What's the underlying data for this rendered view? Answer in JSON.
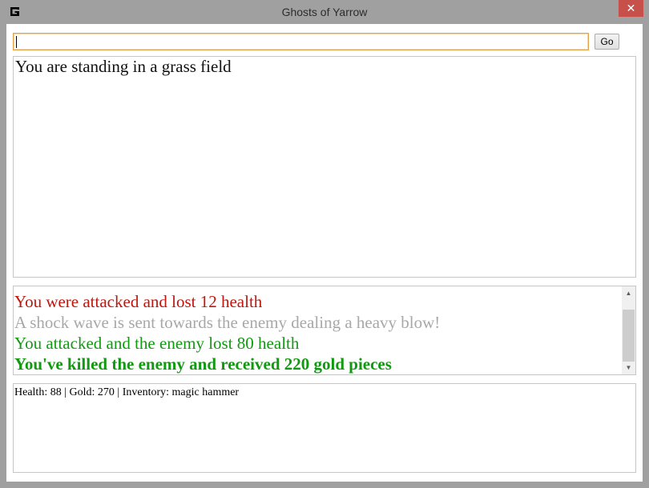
{
  "window": {
    "title": "Ghosts of Yarrow",
    "close_glyph": "✕"
  },
  "command": {
    "value": "",
    "go_label": "Go"
  },
  "location": {
    "text": "You are standing in a grass field"
  },
  "log": {
    "lines": [
      {
        "text": "You were attacked and lost 12 health",
        "color": "#c0140c",
        "bold": false
      },
      {
        "text": "A shock wave is sent towards the enemy dealing a heavy blow!",
        "color": "#a8a8a8",
        "bold": false
      },
      {
        "text": "You attacked and the enemy lost 80 health",
        "color": "#119a11",
        "bold": false
      },
      {
        "text": "You've killed the enemy and received 220 gold pieces",
        "color": "#119a11",
        "bold": true
      }
    ]
  },
  "status": {
    "text": "Health: 88 | Gold: 270 | Inventory: magic hammer"
  },
  "icons": {
    "app": "app-logo-icon",
    "close": "close-icon",
    "scroll_up": "scroll-up-icon",
    "scroll_down": "scroll-down-icon"
  },
  "colors": {
    "frame": "#a0a0a0",
    "close_button": "#c7504b",
    "input_focus_border": "#e3a248"
  }
}
